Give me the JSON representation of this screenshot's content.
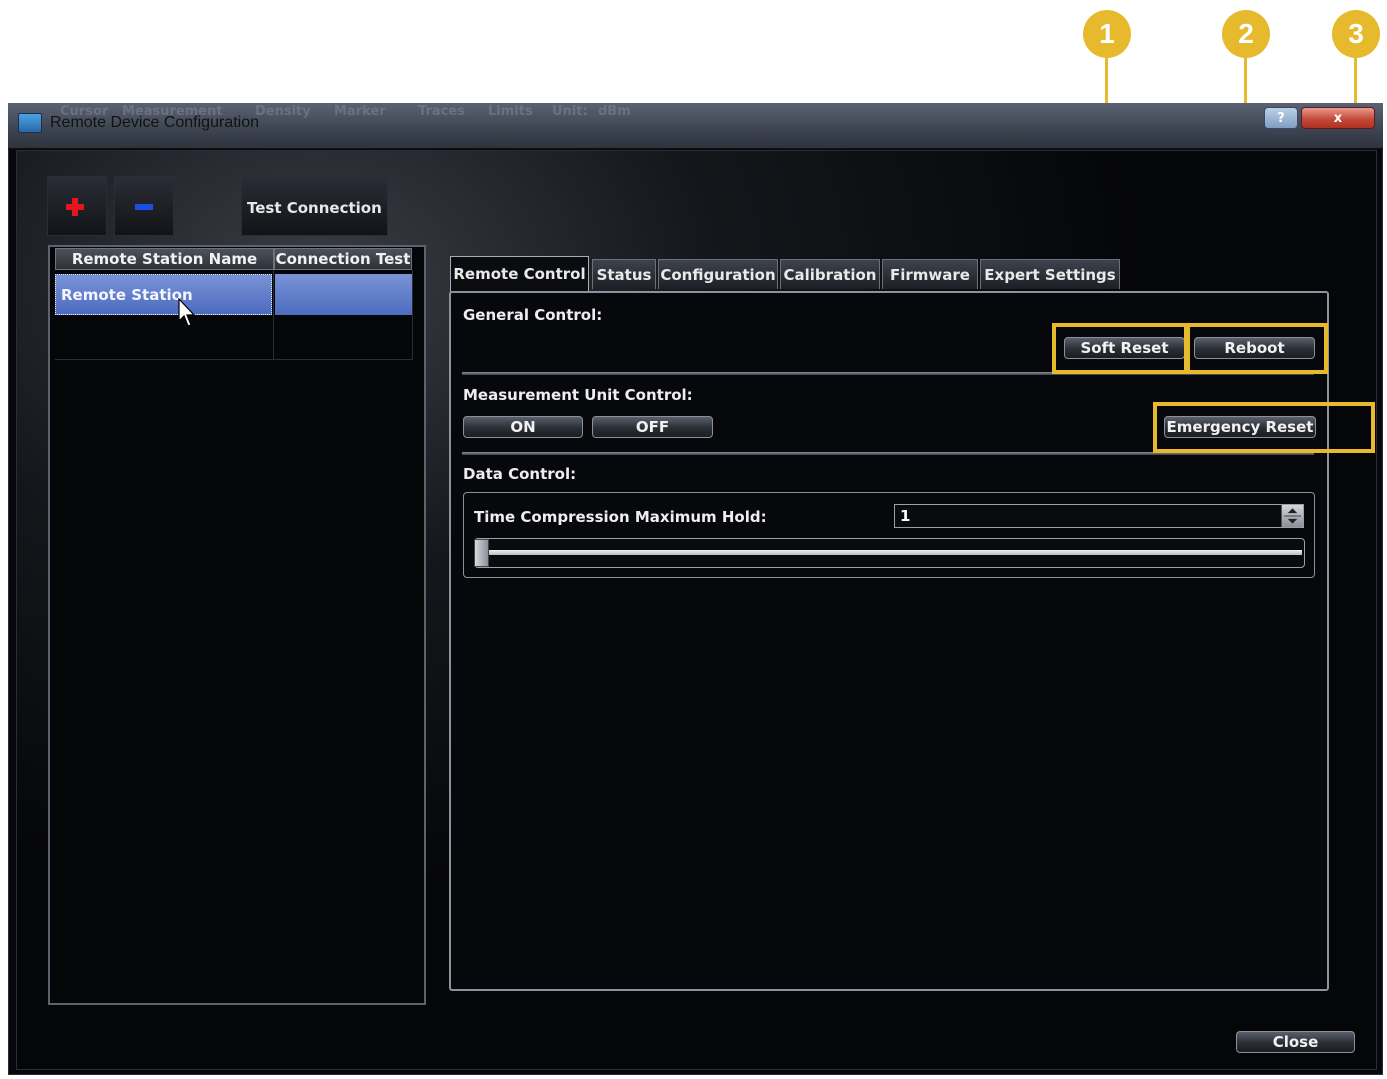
{
  "window": {
    "title": "Remote Device Configuration",
    "help_label": "?",
    "close_label": "x"
  },
  "background_menu": [
    "Cursor",
    "Measurement",
    "Density",
    "Marker",
    "Traces",
    "Limits",
    "Unit:",
    "dBm"
  ],
  "toolbar": {
    "add_icon": "plus-icon",
    "remove_icon": "minus-icon",
    "test_connection_label": "Test Connection"
  },
  "station_list": {
    "columns": [
      "Remote Station Name",
      "Connection Test"
    ],
    "rows": [
      {
        "name": "Remote Station",
        "connection_test": ""
      }
    ]
  },
  "tabs": [
    "Remote Control",
    "Status",
    "Configuration",
    "Calibration",
    "Firmware",
    "Expert Settings"
  ],
  "active_tab": "Remote Control",
  "general_control": {
    "heading": "General Control:",
    "soft_reset_label": "Soft Reset",
    "reboot_label": "Reboot"
  },
  "measurement_unit_control": {
    "heading": "Measurement Unit Control:",
    "on_label": "ON",
    "off_label": "OFF",
    "emergency_reset_label": "Emergency Reset"
  },
  "data_control": {
    "heading": "Data Control:",
    "time_compression_label": "Time Compression Maximum Hold:",
    "time_compression_value": "1"
  },
  "footer": {
    "close_label": "Close"
  },
  "callouts": [
    "1",
    "2",
    "3"
  ],
  "colors": {
    "callout": "#e7b92c",
    "selection": "#5b78c8",
    "add_icon": "#e4151c",
    "remove_icon": "#1a4fe6"
  }
}
